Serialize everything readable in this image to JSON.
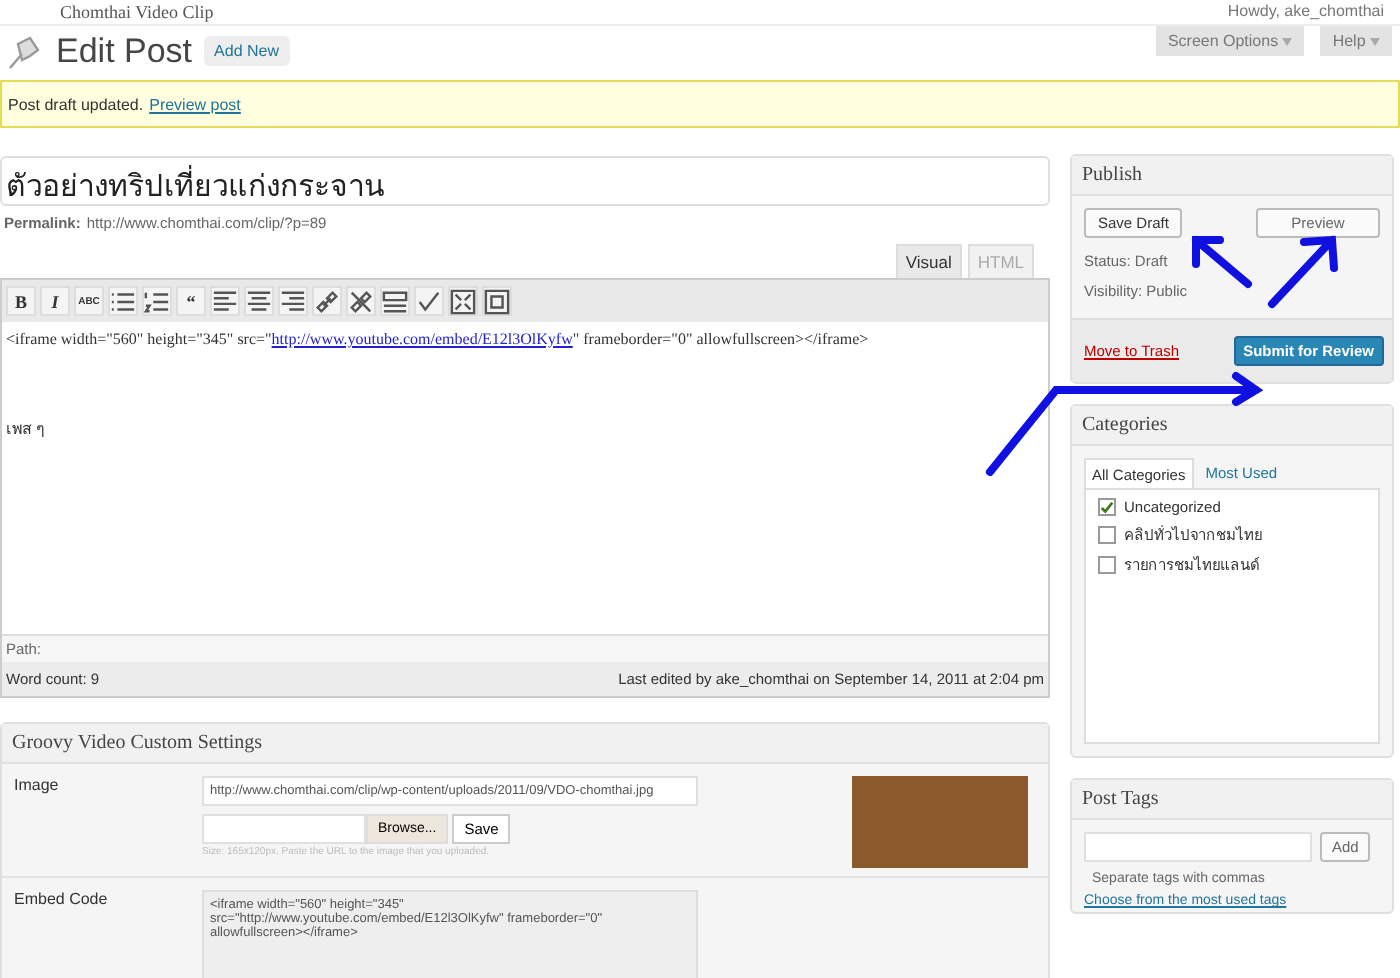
{
  "admin_bar": {
    "site_title": "Chomthai Video Clip",
    "greeting": "Howdy, ake_chomthai"
  },
  "header": {
    "title": "Edit Post",
    "add_new": "Add New",
    "screen_options": "Screen Options",
    "help": "Help"
  },
  "notice": {
    "text": "Post draft updated.",
    "link": "Preview post"
  },
  "post": {
    "title": "ตัวอย่างทริปเที่ยวแก่งกระจาน",
    "permalink_label": "Permalink:",
    "permalink": "http://www.chomthai.com/clip/?p=89"
  },
  "editor": {
    "tabs": [
      {
        "label": "Visual",
        "selected": true
      },
      {
        "label": "HTML",
        "selected": false
      }
    ],
    "toolbar": [
      {
        "kind": "bold",
        "label": "B"
      },
      {
        "kind": "italic",
        "label": "I"
      },
      {
        "kind": "strike",
        "label": "ABC"
      },
      {
        "kind": "bullets"
      },
      {
        "kind": "numbers"
      },
      {
        "kind": "quote",
        "label": "“"
      },
      {
        "kind": "left"
      },
      {
        "kind": "center"
      },
      {
        "kind": "right"
      },
      {
        "kind": "link"
      },
      {
        "kind": "unlink"
      },
      {
        "kind": "more"
      },
      {
        "kind": "spell"
      },
      {
        "kind": "fullscreen"
      },
      {
        "kind": "sink"
      }
    ],
    "content_before": "<iframe width=\"560\" height=\"345\" src=\"",
    "content_link": "http://www.youtube.com/embed/E12l3OlKyfw",
    "content_after": "\" frameborder=\"0\" allowfullscreen></iframe>",
    "content_line2": "เพส ๆ",
    "path": "Path:",
    "word_count": "Word count: 9",
    "last_edited": "Last edited by ake_chomthai on September 14, 2011 at 2:04 pm"
  },
  "video_settings": {
    "title": "Groovy Video Custom Settings",
    "image_label": "Image",
    "image_url": "http://www.chomthai.com/clip/wp-content/uploads/2011/09/VDO-chomthai.jpg",
    "browse": "Browse...",
    "save": "Save",
    "hint": "Size: 165x120px. Paste the URL to the image that you uploaded.",
    "embed_label": "Embed Code",
    "embed_code": "<iframe width=\"560\" height=\"345\" src=\"http://www.youtube.com/embed/E12l3OlKyfw\" frameborder=\"0\" allowfullscreen></iframe>"
  },
  "publish": {
    "title": "Publish",
    "save_draft": "Save Draft",
    "preview": "Preview",
    "status": "Status: Draft",
    "visibility": "Visibility: Public",
    "trash": "Move to Trash",
    "submit": "Submit for Review"
  },
  "categories": {
    "title": "Categories",
    "tabs": [
      {
        "label": "All Categories",
        "selected": true
      },
      {
        "label": "Most Used",
        "selected": false
      }
    ],
    "items": [
      {
        "label": "Uncategorized",
        "checked": true
      },
      {
        "label": "คลิปทั่วไปจากชมไทย",
        "checked": false
      },
      {
        "label": "รายการชมไทยแลนด์",
        "checked": false
      }
    ]
  },
  "tags": {
    "title": "Post Tags",
    "add": "Add",
    "hint": "Separate tags with commas",
    "link": "Choose from the most used tags"
  }
}
